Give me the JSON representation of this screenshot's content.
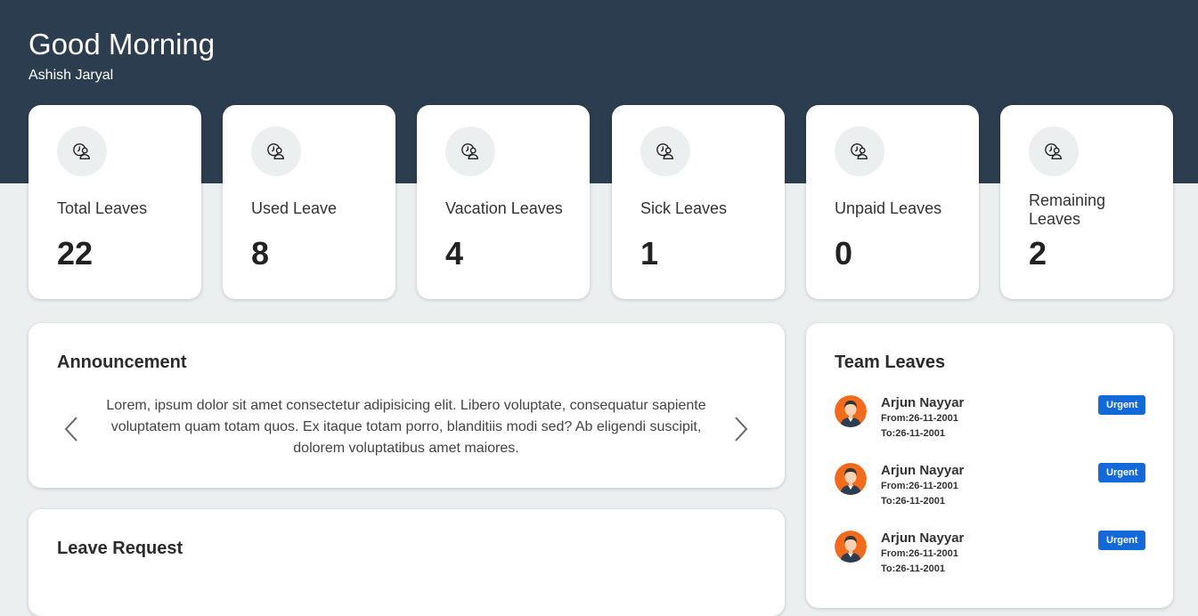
{
  "header": {
    "greeting": "Good Morning",
    "user_name": "Ashish Jaryal"
  },
  "stats": [
    {
      "label": "Total Leaves",
      "value": "22",
      "icon": "leave-clock-user-icon"
    },
    {
      "label": "Used Leave",
      "value": "8",
      "icon": "leave-clock-user-icon"
    },
    {
      "label": "Vacation Leaves",
      "value": "4",
      "icon": "leave-clock-user-icon"
    },
    {
      "label": "Sick Leaves",
      "value": "1",
      "icon": "leave-clock-user-icon"
    },
    {
      "label": "Unpaid Leaves",
      "value": "0",
      "icon": "leave-clock-user-icon"
    },
    {
      "label": "Remaining Leaves",
      "value": "2",
      "icon": "leave-clock-user-icon"
    }
  ],
  "announcement": {
    "title": "Announcement",
    "text": "Lorem, ipsum dolor sit amet consectetur adipisicing elit. Libero voluptate, consequatur sapiente voluptatem quam totam quos. Ex itaque totam porro, blanditiis modi sed? Ab eligendi suscipit, dolorem voluptatibus amet maiores.",
    "prev_icon": "chevron-left-icon",
    "next_icon": "chevron-right-icon"
  },
  "leave_request": {
    "title": "Leave Request"
  },
  "team_leaves": {
    "title": "Team Leaves",
    "members": [
      {
        "name": "Arjun Nayyar",
        "from": "From:26-11-2001",
        "to": "To:26-11-2001",
        "badge": "Urgent"
      },
      {
        "name": "Arjun Nayyar",
        "from": "From:26-11-2001",
        "to": "To:26-11-2001",
        "badge": "Urgent"
      },
      {
        "name": "Arjun Nayyar",
        "from": "From:26-11-2001",
        "to": "To:26-11-2001",
        "badge": "Urgent"
      }
    ]
  },
  "colors": {
    "header_bg": "#2d3d50",
    "page_bg": "#eceff0",
    "badge_bg": "#1469d8",
    "avatar_bg": "#f26b1d"
  }
}
